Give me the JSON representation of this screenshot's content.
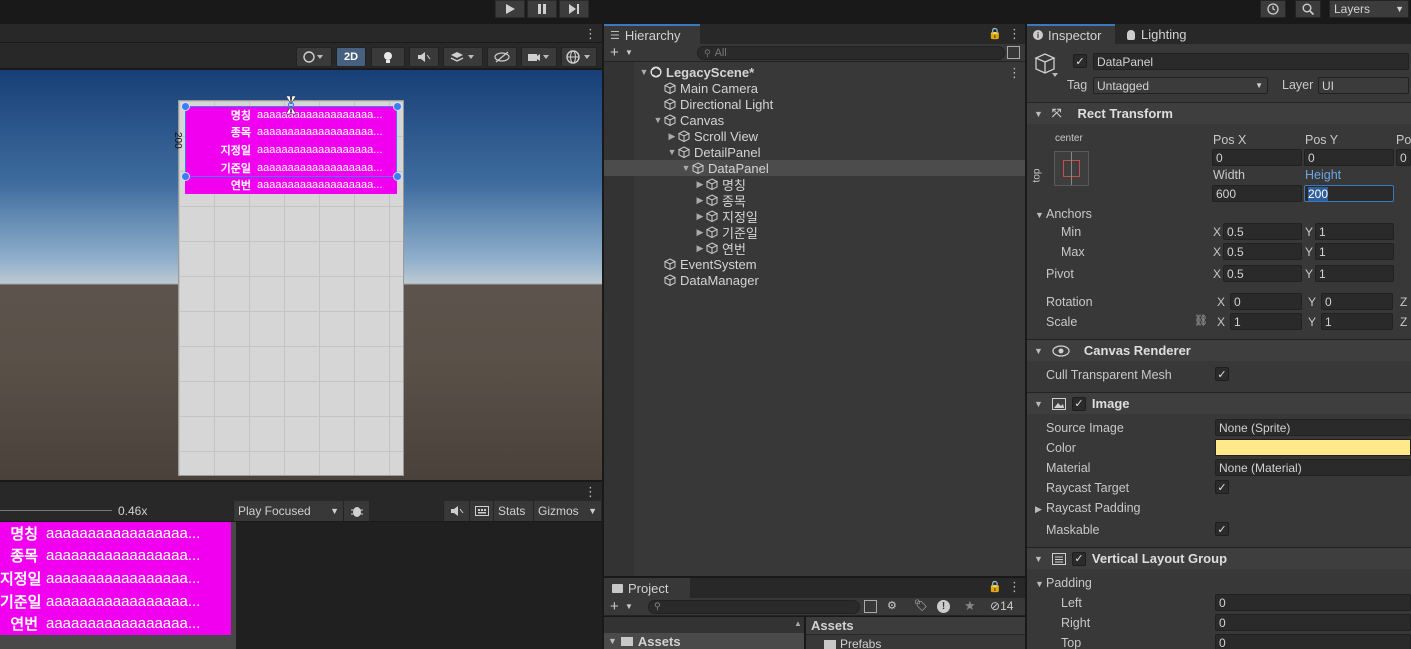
{
  "toolbar": {
    "layers_label": "Layers",
    "history_icon": "history-icon",
    "search_icon": "search-icon"
  },
  "scene": {
    "mode_2d": "2D",
    "panel_title_value": "200",
    "rows": [
      {
        "label": "명칭",
        "value": "aaaaaaaaaaaaaaaaaaa..."
      },
      {
        "label": "종목",
        "value": "aaaaaaaaaaaaaaaaaaa..."
      },
      {
        "label": "지정일",
        "value": "aaaaaaaaaaaaaaaaaaa..."
      },
      {
        "label": "기준일",
        "value": "aaaaaaaaaaaaaaaaaaa..."
      },
      {
        "label": "연번",
        "value": "aaaaaaaaaaaaaaaaaaa..."
      }
    ]
  },
  "game": {
    "scale": "0.46x",
    "play_mode": "Play Focused",
    "stats": "Stats",
    "gizmos": "Gizmos",
    "rows": [
      {
        "label": "명칭",
        "value": "aaaaaaaaaaaaaaaaa..."
      },
      {
        "label": "종목",
        "value": "aaaaaaaaaaaaaaaaa..."
      },
      {
        "label": "지정일",
        "value": "aaaaaaaaaaaaaaaaa..."
      },
      {
        "label": "기준일",
        "value": "aaaaaaaaaaaaaaaaa..."
      },
      {
        "label": "연번",
        "value": "aaaaaaaaaaaaaaaaa..."
      }
    ]
  },
  "hierarchy": {
    "tab": "Hierarchy",
    "search_placeholder": "All",
    "items": [
      {
        "label": "LegacyScene*",
        "depth": 0,
        "arrow": "▼",
        "kind": "scene"
      },
      {
        "label": "Main Camera",
        "depth": 1,
        "arrow": "",
        "kind": "object"
      },
      {
        "label": "Directional Light",
        "depth": 1,
        "arrow": "",
        "kind": "object"
      },
      {
        "label": "Canvas",
        "depth": 1,
        "arrow": "▼",
        "kind": "object"
      },
      {
        "label": "Scroll View",
        "depth": 2,
        "arrow": "▶",
        "kind": "object"
      },
      {
        "label": "DetailPanel",
        "depth": 2,
        "arrow": "▼",
        "kind": "object"
      },
      {
        "label": "DataPanel",
        "depth": 3,
        "arrow": "▼",
        "kind": "object",
        "selected": true
      },
      {
        "label": "명칭",
        "depth": 4,
        "arrow": "▶",
        "kind": "object"
      },
      {
        "label": "종목",
        "depth": 4,
        "arrow": "▶",
        "kind": "object"
      },
      {
        "label": "지정일",
        "depth": 4,
        "arrow": "▶",
        "kind": "object"
      },
      {
        "label": "기준일",
        "depth": 4,
        "arrow": "▶",
        "kind": "object"
      },
      {
        "label": "연번",
        "depth": 4,
        "arrow": "▶",
        "kind": "object"
      },
      {
        "label": "EventSystem",
        "depth": 1,
        "arrow": "",
        "kind": "object"
      },
      {
        "label": "DataManager",
        "depth": 1,
        "arrow": "",
        "kind": "object"
      }
    ]
  },
  "project": {
    "tab": "Project",
    "hidden_count": "14",
    "assets_left": "Assets",
    "assets_right": "Assets",
    "prefabs": "Prefabs"
  },
  "inspector": {
    "tab_inspector": "Inspector",
    "tab_lighting": "Lighting",
    "object_name": "DataPanel",
    "tag_label": "Tag",
    "tag_value": "Untagged",
    "layer_label": "Layer",
    "layer_value": "UI",
    "rect_transform": {
      "title": "Rect Transform",
      "anchor_h": "center",
      "anchor_v": "top",
      "pos_x_label": "Pos X",
      "pos_y_label": "Pos Y",
      "pos_z_label": "Po",
      "pos_x": "0",
      "pos_y": "0",
      "pos_z": "0",
      "width_label": "Width",
      "height_label": "Height",
      "width": "600",
      "height": "200",
      "anchors_label": "Anchors",
      "min_label": "Min",
      "max_label": "Max",
      "min_x": "0.5",
      "min_y": "1",
      "max_x": "0.5",
      "max_y": "1",
      "pivot_label": "Pivot",
      "pivot_x": "0.5",
      "pivot_y": "1",
      "rotation_label": "Rotation",
      "rot_x": "0",
      "rot_y": "0",
      "scale_label": "Scale",
      "scale_x": "1",
      "scale_y": "1",
      "axis_x": "X",
      "axis_y": "Y",
      "axis_z": "Z"
    },
    "canvas_renderer": {
      "title": "Canvas Renderer",
      "cull_label": "Cull Transparent Mesh"
    },
    "image": {
      "title": "Image",
      "source_label": "Source Image",
      "source_value": "None (Sprite)",
      "color_label": "Color",
      "color_value": "#ffe98a",
      "material_label": "Material",
      "material_value": "None (Material)",
      "raycast_target_label": "Raycast Target",
      "raycast_padding_label": "Raycast Padding",
      "maskable_label": "Maskable"
    },
    "vlg": {
      "title": "Vertical Layout Group",
      "padding_label": "Padding",
      "left_label": "Left",
      "left": "0",
      "right_label": "Right",
      "right": "0",
      "top_label": "Top",
      "top": "0"
    }
  }
}
